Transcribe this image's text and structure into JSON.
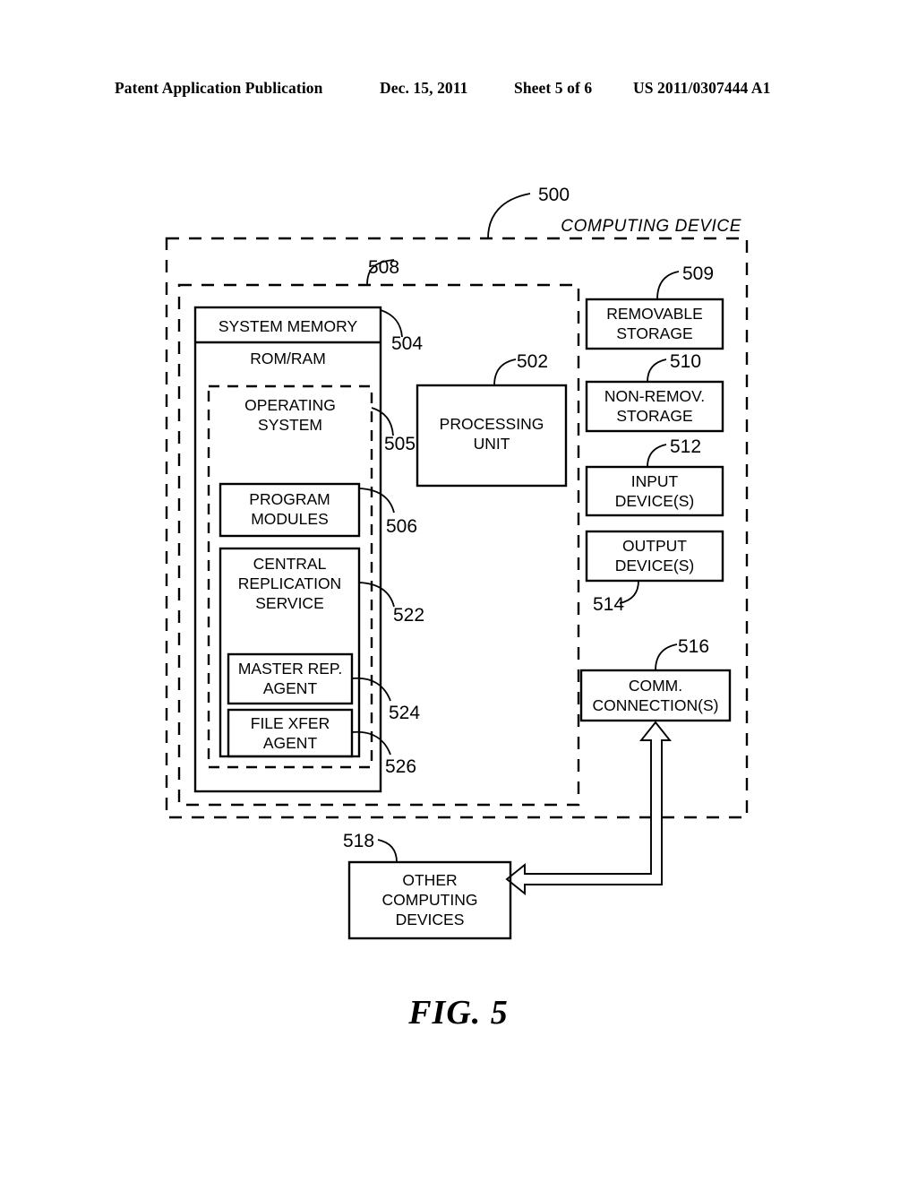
{
  "header": {
    "publication": "Patent Application Publication",
    "date": "Dec. 15, 2011",
    "sheet": "Sheet 5 of 6",
    "number": "US 2011/0307444 A1"
  },
  "figure": {
    "caption": "FIG. 5",
    "outer_label": "COMPUTING DEVICE",
    "outer_ref": "500",
    "inner_ref": "508"
  },
  "boxes": {
    "system_memory": {
      "title": "SYSTEM MEMORY",
      "sub": "ROM/RAM",
      "ref": "504"
    },
    "operating_system": {
      "line1": "OPERATING",
      "line2": "SYSTEM",
      "ref": "505"
    },
    "program_modules": {
      "line1": "PROGRAM",
      "line2": "MODULES",
      "ref": "506"
    },
    "central_replication_service": {
      "line1": "CENTRAL",
      "line2": "REPLICATION",
      "line3": "SERVICE",
      "ref": "522"
    },
    "master_rep_agent": {
      "line1": "MASTER REP.",
      "line2": "AGENT",
      "ref": "524"
    },
    "file_xfer_agent": {
      "line1": "FILE XFER",
      "line2": "AGENT",
      "ref": "526"
    },
    "processing_unit": {
      "line1": "PROCESSING",
      "line2": "UNIT",
      "ref": "502"
    },
    "removable_storage": {
      "line1": "REMOVABLE",
      "line2": "STORAGE",
      "ref": "509"
    },
    "non_removable_storage": {
      "line1": "NON-REMOV.",
      "line2": "STORAGE",
      "ref": "510"
    },
    "input_devices": {
      "line1": "INPUT",
      "line2": "DEVICE(S)",
      "ref": "512"
    },
    "output_devices": {
      "line1": "OUTPUT",
      "line2": "DEVICE(S)",
      "ref": "514"
    },
    "comm_connections": {
      "line1": "COMM.",
      "line2": "CONNECTION(S)",
      "ref": "516"
    },
    "other_computing_devices": {
      "line1": "OTHER",
      "line2": "COMPUTING",
      "line3": "DEVICES",
      "ref": "518"
    }
  }
}
